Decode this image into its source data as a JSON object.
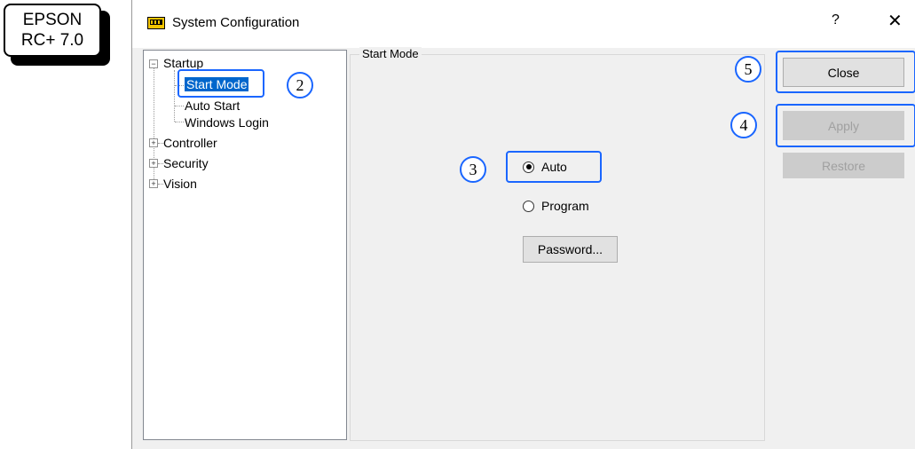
{
  "badge": {
    "line1": "EPSON",
    "line2": "RC+ 7.0"
  },
  "window": {
    "title": "System Configuration",
    "help": "?",
    "close": "✕"
  },
  "tree": {
    "startup": "Startup",
    "start_mode": "Start Mode",
    "auto_start": "Auto Start",
    "windows_login": "Windows Login",
    "controller": "Controller",
    "security": "Security",
    "vision": "Vision"
  },
  "panel": {
    "group_label": "Start Mode",
    "radio_auto": "Auto",
    "radio_program": "Program",
    "selected": "Auto",
    "password_button": "Password..."
  },
  "buttons": {
    "close": "Close",
    "apply": "Apply",
    "restore": "Restore"
  },
  "callouts": {
    "c2": "2",
    "c3": "3",
    "c4": "4",
    "c5": "5"
  },
  "colors": {
    "highlight": "#1a66ff",
    "selection": "#0066cc"
  }
}
